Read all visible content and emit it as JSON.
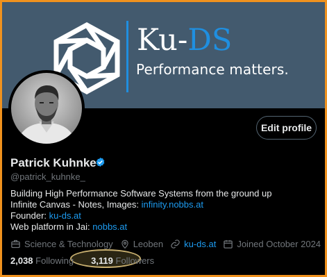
{
  "banner": {
    "logo_prefix": "Ku-",
    "logo_accent": "DS",
    "tagline": "Performance matters.",
    "accent_color": "#1f8fe0",
    "background_color": "#435a6e"
  },
  "profile": {
    "edit_button_label": "Edit profile",
    "display_name": "Patrick Kuhnke",
    "handle": "@patrick_kuhnke_",
    "verified_icon": "verified-badge-icon",
    "bio": {
      "line1": "Building High Performance Software Systems from the ground up",
      "line2_text": "Infinite Canvas - Notes, Images: ",
      "line2_link": "infinity.nobbs.at",
      "line3_text": "Founder: ",
      "line3_link": "ku-ds.at",
      "line4_text": "Web platform in Jai: ",
      "line4_link": "nobbs.at"
    },
    "meta": {
      "category": "Science & Technology",
      "location": "Leoben",
      "website": "ku-ds.at",
      "joined": "Joined October 2024"
    },
    "stats": {
      "following_count": "2,038",
      "following_label": "Following",
      "followers_count": "3,119",
      "followers_label": "Followers"
    }
  },
  "colors": {
    "link": "#1d9bf0",
    "frame_border": "#f0921e",
    "followers_highlight": "#c9b070"
  }
}
